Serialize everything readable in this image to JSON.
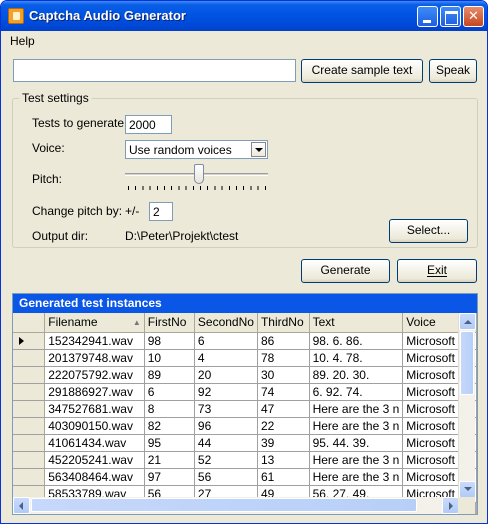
{
  "window": {
    "title": "Captcha Audio Generator"
  },
  "menu": [
    "Help"
  ],
  "toolbar": {
    "sample_text": "",
    "create_sample_label": "Create sample text",
    "speak_label": "Speak"
  },
  "settings": {
    "group_title": "Test settings",
    "tests_label": "Tests to generate:",
    "tests_value": "2000",
    "voice_label": "Voice:",
    "voice_value": "Use random voices",
    "pitch_label": "Pitch:",
    "pitch_level": 0.5,
    "change_pitch_label": "Change pitch by:",
    "pitch_sign": "+/-",
    "pitch_value": "2",
    "output_label": "Output dir:",
    "output_path": "D:\\Peter\\Projekt\\ctest",
    "select_label": "Select..."
  },
  "actions": {
    "generate_label": "Generate",
    "exit_label": "Exit"
  },
  "grid": {
    "caption": "Generated test instances",
    "columns": [
      "Filename",
      "FirstNo",
      "SecondNo",
      "ThirdNo",
      "Text",
      "Voice"
    ],
    "rows": [
      [
        "152342941.wav",
        "98",
        "6",
        "86",
        "98. 6. 86.",
        "Microsoft Sa"
      ],
      [
        "201379748.wav",
        "10",
        "4",
        "78",
        "10. 4. 78.",
        "Microsoft M"
      ],
      [
        "222075792.wav",
        "89",
        "20",
        "30",
        "89. 20. 30.",
        "Microsoft Sa"
      ],
      [
        "291886927.wav",
        "6",
        "92",
        "74",
        "6. 92. 74.",
        "Microsoft M"
      ],
      [
        "347527681.wav",
        "8",
        "73",
        "47",
        "Here are the 3 n",
        "Microsoft M"
      ],
      [
        "403090150.wav",
        "82",
        "96",
        "22",
        "Here are the 3 n",
        "Microsoft Sa"
      ],
      [
        "41061434.wav",
        "95",
        "44",
        "39",
        "95. 44. 39.",
        "Microsoft Sa"
      ],
      [
        "452205241.wav",
        "21",
        "52",
        "13",
        "Here are the 3 n",
        "Microsoft Sa"
      ],
      [
        "563408464.wav",
        "97",
        "56",
        "61",
        "Here are the 3 n",
        "Microsoft M"
      ],
      [
        "58533789.wav",
        "56",
        "27",
        "49",
        "56. 27. 49.",
        "Microsoft Sa"
      ]
    ]
  }
}
